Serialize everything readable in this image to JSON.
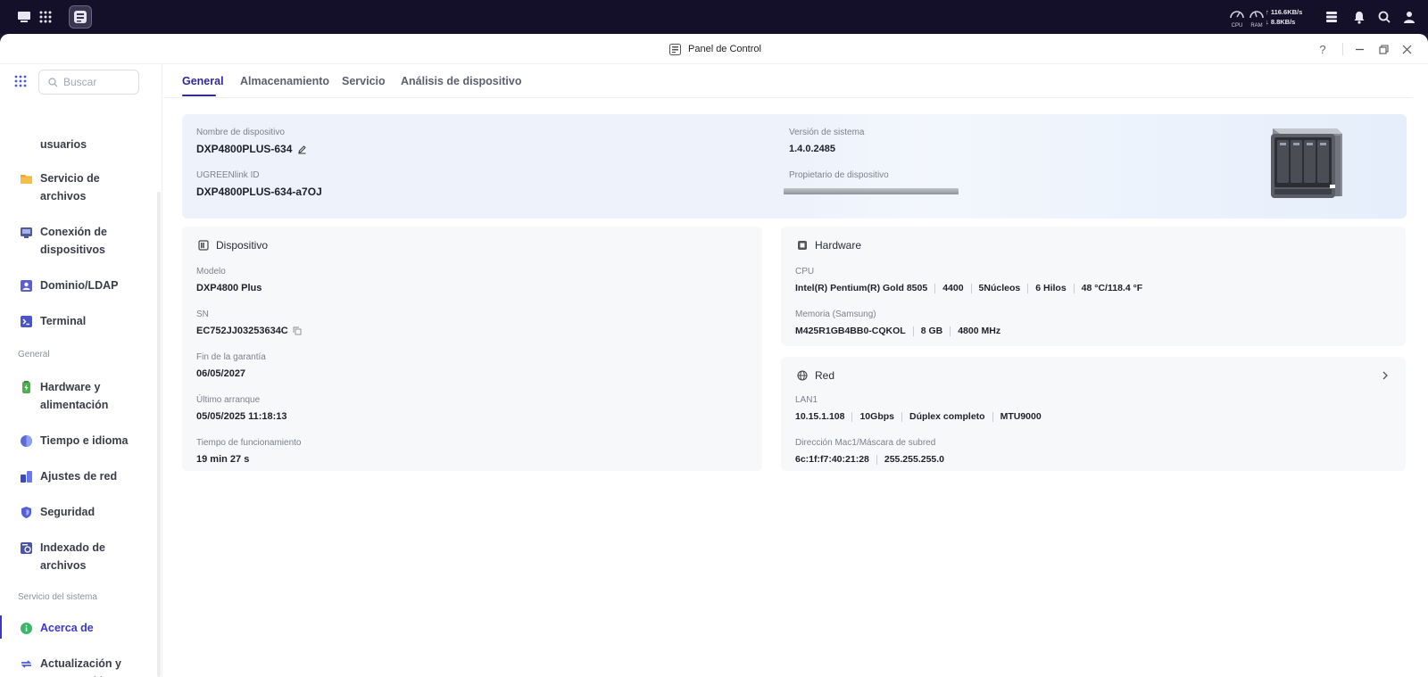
{
  "topbar": {
    "cpu_label": "CPU",
    "ram_label": "RAM",
    "net_up": "↑ 116.6KB/s",
    "net_down": "↓ 8.8KB/s"
  },
  "window": {
    "title": "Panel de Control",
    "help": "?"
  },
  "sidebar": {
    "search_placeholder": "Buscar",
    "items": [
      {
        "label": "usuarios"
      },
      {
        "label": "Servicio de archivos"
      },
      {
        "label": "Conexión de dispositivos"
      },
      {
        "label": "Dominio/LDAP"
      },
      {
        "label": "Terminal"
      },
      {
        "label": "Hardware y alimentación"
      },
      {
        "label": "Tiempo e idioma"
      },
      {
        "label": "Ajustes de red"
      },
      {
        "label": "Seguridad"
      },
      {
        "label": "Indexado de archivos"
      },
      {
        "label": "Acerca de"
      },
      {
        "label": "Actualización y recuperación"
      }
    ],
    "sections": [
      "General",
      "Servicio del sistema"
    ]
  },
  "tabs": [
    "General",
    "Almacenamiento",
    "Servicio",
    "Análisis de dispositivo"
  ],
  "hero": {
    "device_name_label": "Nombre de dispositivo",
    "device_name": "DXP4800PLUS-634",
    "link_id_label": "UGREENlink ID",
    "link_id": "DXP4800PLUS-634-a7OJ",
    "version_label": "Versión de sistema",
    "version": "1.4.0.2485",
    "owner_label": "Propietario de dispositivo"
  },
  "device_card": {
    "title": "Dispositivo",
    "model_label": "Modelo",
    "model": "DXP4800 Plus",
    "sn_label": "SN",
    "sn": "EC752JJ03253634C",
    "warranty_label": "Fin de la garantía",
    "warranty": "06/05/2027",
    "boot_label": "Último arranque",
    "boot": "05/05/2025 11:18:13",
    "uptime_label": "Tiempo de funcionamiento",
    "uptime": "19 min 27 s"
  },
  "hardware_card": {
    "title": "Hardware",
    "cpu_label": "CPU",
    "cpu": [
      "Intel(R) Pentium(R) Gold 8505",
      "4400",
      "5Núcleos",
      "6 Hilos",
      "48 °C/118.4 °F"
    ],
    "mem_label": "Memoria (Samsung)",
    "mem": [
      "M425R1GB4BB0-CQKOL",
      "8 GB",
      "4800 MHz"
    ]
  },
  "network_card": {
    "title": "Red",
    "lan_label": "LAN1",
    "lan": [
      "10.15.1.108",
      "10Gbps",
      "Dúplex completo",
      "MTU9000"
    ],
    "mac_label": "Dirección Mac1/Máscara de subred",
    "mac": [
      "6c:1f:f7:40:21:28",
      "255.255.255.0"
    ]
  }
}
